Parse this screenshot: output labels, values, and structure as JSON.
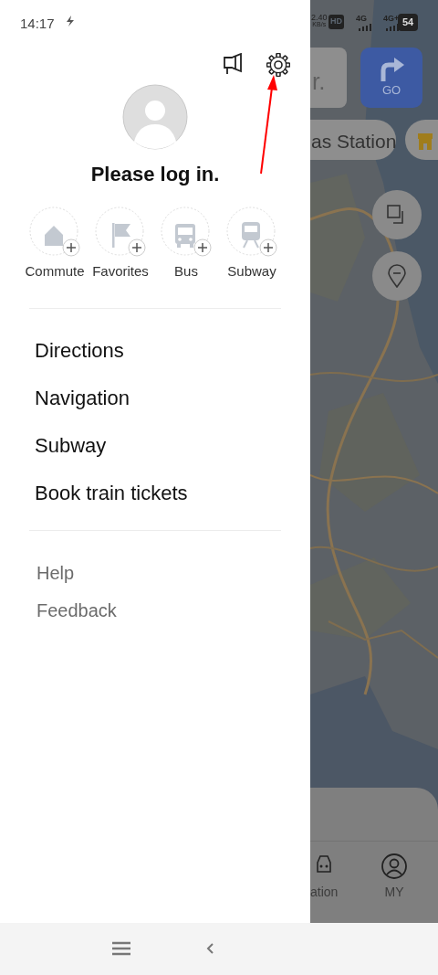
{
  "status_bar": {
    "time": "14:17",
    "net_speed": "2.40",
    "net_unit": "KB/s",
    "hd_badge": "HD",
    "signals": [
      "4G",
      "4G+"
    ],
    "battery": "54"
  },
  "drawer": {
    "login_prompt": "Please log in.",
    "shortcuts": [
      {
        "label": "Commute",
        "kind": "home"
      },
      {
        "label": "Favorites",
        "kind": "flag"
      },
      {
        "label": "Bus",
        "kind": "bus"
      },
      {
        "label": "Subway",
        "kind": "train"
      }
    ],
    "menu": [
      "Directions",
      "Navigation",
      "Subway",
      "Book train tickets"
    ],
    "secondary": [
      "Help",
      "Feedback"
    ]
  },
  "map_screen": {
    "search_text": "r.",
    "go_button": "GO",
    "chip": "as Station",
    "bottom_nav": [
      {
        "label": "ation",
        "kind": "car"
      },
      {
        "label": "MY",
        "kind": "person"
      }
    ]
  }
}
